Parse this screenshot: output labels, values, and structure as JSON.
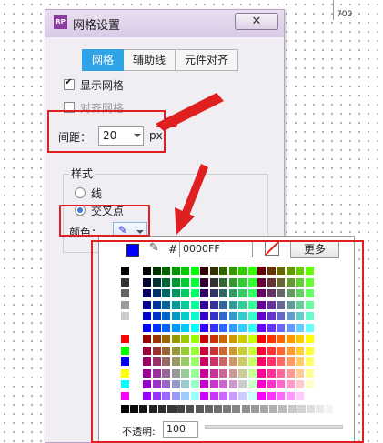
{
  "ruler": {
    "mark": "700"
  },
  "dialog": {
    "title": "网格设置",
    "app_icon_text": "RP",
    "close_glyph": "✕",
    "tabs": [
      {
        "label": "网格",
        "active": true
      },
      {
        "label": "辅助线",
        "active": false
      },
      {
        "label": "元件对齐",
        "active": false
      }
    ],
    "show_grid": {
      "label": "显示网格",
      "checked": true
    },
    "snap_grid": {
      "label": "对齐网格",
      "checked": false
    },
    "spacing": {
      "label": "间距：",
      "value": "20",
      "unit": "px"
    },
    "style": {
      "title": "样式",
      "options": [
        {
          "label": "线",
          "checked": false
        },
        {
          "label": "交叉点",
          "checked": true
        }
      ]
    },
    "color": {
      "label": "颜色：",
      "value": "#0000ff",
      "icon": "pen-icon"
    }
  },
  "picker": {
    "selected_color": "#0000FF",
    "hash_label": "#",
    "hex_value": "0000FF",
    "more_label": "更多",
    "opacity_label": "不透明:",
    "opacity_value": "100"
  },
  "colors": {
    "accent_tab": "#2fa3e6",
    "annotation": "#e02020",
    "selected": "#0000ff"
  }
}
